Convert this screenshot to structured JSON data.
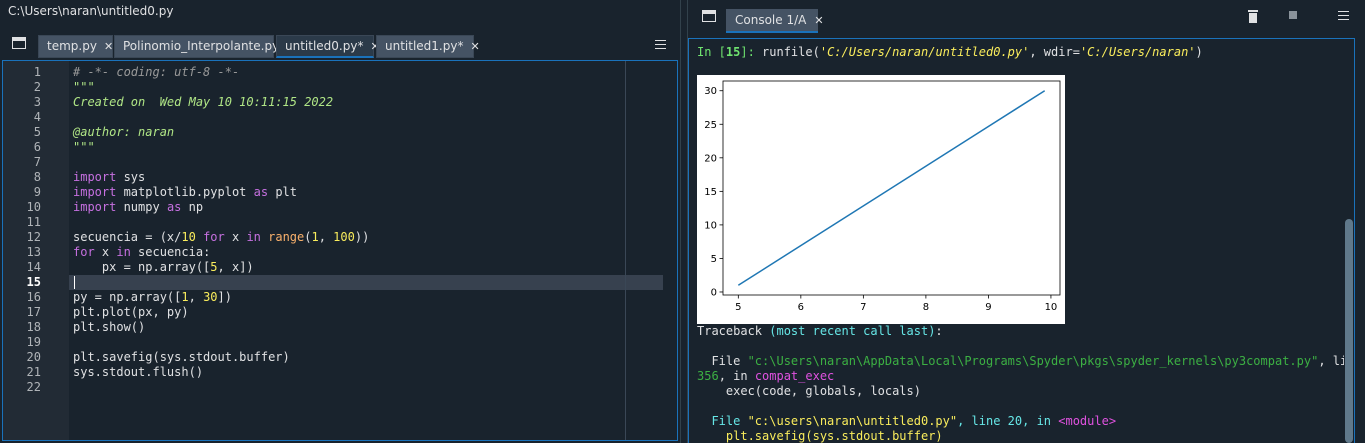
{
  "window": {
    "title": "C:\\Users\\naran\\untitled0.py"
  },
  "editor": {
    "tabs": [
      {
        "label": "temp.py"
      },
      {
        "label": "Polinomio_Interpolante.py"
      },
      {
        "label": "untitled0.py*"
      },
      {
        "label": "untitled1.py*"
      }
    ],
    "active_tab": "untitled0.py*",
    "current_line": "15",
    "line_numbers": [
      "1",
      "2",
      "3",
      "4",
      "5",
      "6",
      "7",
      "8",
      "9",
      "10",
      "11",
      "12",
      "13",
      "14",
      "15",
      "16",
      "17",
      "18",
      "19",
      "20",
      "21",
      "22"
    ],
    "code": {
      "l1": "# -*- coding: utf-8 -*-",
      "l2": "\"\"\"",
      "l3": "Created on  Wed May 10 10:11:15 2022",
      "l5": "@author: naran",
      "l6": "\"\"\"",
      "l8_kw": "import",
      "l8_rest": " sys",
      "l9_kw": "import",
      "l9_mid": " matplotlib.pyplot ",
      "l9_kw2": "as",
      "l9_rest": " plt",
      "l10_kw": "import",
      "l10_mid": " numpy ",
      "l10_kw2": "as",
      "l10_rest": " np",
      "l12_a": "secuencia = (x/",
      "l12_n1": "10",
      "l12_b": " ",
      "l12_kw1": "for",
      "l12_c": " x ",
      "l12_kw2": "in",
      "l12_d": " ",
      "l12_bi": "range",
      "l12_e": "(",
      "l12_n2": "1",
      "l12_f": ", ",
      "l12_n3": "100",
      "l12_g": "))",
      "l13_kw": "for",
      "l13_a": " x ",
      "l13_kw2": "in",
      "l13_b": " secuencia:",
      "l14_a": "    px = np.array([",
      "l14_n": "5",
      "l14_b": ", x])",
      "l16_a": "py = np.array([",
      "l16_n1": "1",
      "l16_b": ", ",
      "l16_n2": "30",
      "l16_c": "])",
      "l17": "plt.plot(px, py)",
      "l18": "plt.show()",
      "l20": "plt.savefig(sys.stdout.buffer)",
      "l21": "sys.stdout.flush()"
    }
  },
  "console": {
    "tab_label": "Console 1/A",
    "prompt_in": "In [",
    "prompt_num": "15",
    "prompt_close": "]:",
    "run_a": " runfile(",
    "run_path": "'C:/Users/naran/untitled0.py'",
    "run_b": ", wdir=",
    "run_wdir": "'C:/Users/naran'",
    "run_c": ")",
    "traceback_label": "Traceback ",
    "traceback_paren": "(most recent call last)",
    "traceback_colon": ":",
    "tb1_file": "  File ",
    "tb1_path": "\"c:\\Users\\naran\\AppData\\Local\\Programs\\Spyder\\pkgs\\spyder_kernels\\py3compat.py\"",
    "tb1_line": ", line",
    "tb1_num": "356",
    "tb1_in": ", in ",
    "tb1_func": "compat_exec",
    "tb1_code": "    exec(code, globals, locals)",
    "tb2_file": "  File ",
    "tb2_path": "\"c:\\users\\naran\\untitled0.py\"",
    "tb2_line": ", line ",
    "tb2_num": "20",
    "tb2_in": ", in ",
    "tb2_func": "<module>",
    "tb2_code": "    plt.savefig(sys.stdout.buffer)"
  },
  "chart_data": {
    "type": "line",
    "x": [
      5,
      9.9
    ],
    "y": [
      1,
      30
    ],
    "xticks": [
      "5",
      "6",
      "7",
      "8",
      "9",
      "10"
    ],
    "yticks": [
      "0",
      "5",
      "10",
      "15",
      "20",
      "25",
      "30"
    ],
    "xlim": [
      4.755,
      10.145
    ],
    "ylim": [
      -0.45,
      31.45
    ],
    "line_color": "#1f77b4",
    "grid": false
  },
  "colors": {
    "accent": "#1a72bb",
    "background": "#19232d"
  },
  "icons": {
    "editor_pane": "pane-icon",
    "editor_menu": "hamburger-menu-icon",
    "console_pane": "pane-icon",
    "console_clear": "trash-icon",
    "console_stop": "stop-icon",
    "console_menu": "hamburger-menu-icon"
  }
}
